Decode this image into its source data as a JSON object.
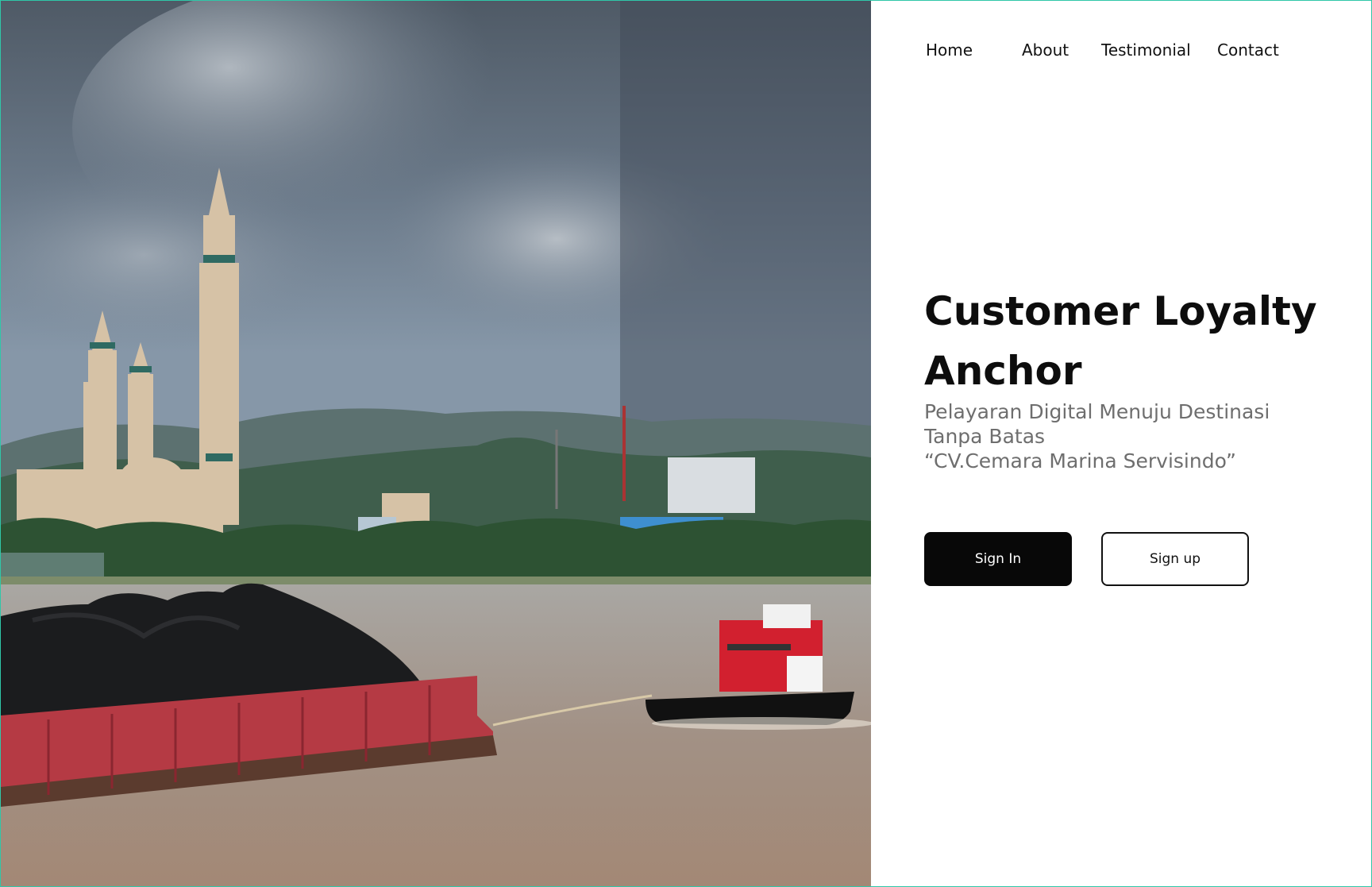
{
  "nav": {
    "home": "Home",
    "about": "About",
    "testimonial": "Testimonial",
    "contact": "Contact"
  },
  "hero": {
    "title_line1": "Customer Loyalty",
    "title_line2": "Anchor",
    "subtitle_line1": "Pelayaran Digital Menuju Destinasi",
    "subtitle_line2": "Tanpa Batas",
    "subtitle_line3": "“CV.Cemara Marina Servisindo”"
  },
  "actions": {
    "sign_in": "Sign In",
    "sign_up": "Sign up"
  },
  "colors": {
    "frame": "#2fc7a8",
    "primary_button": "#080808"
  }
}
